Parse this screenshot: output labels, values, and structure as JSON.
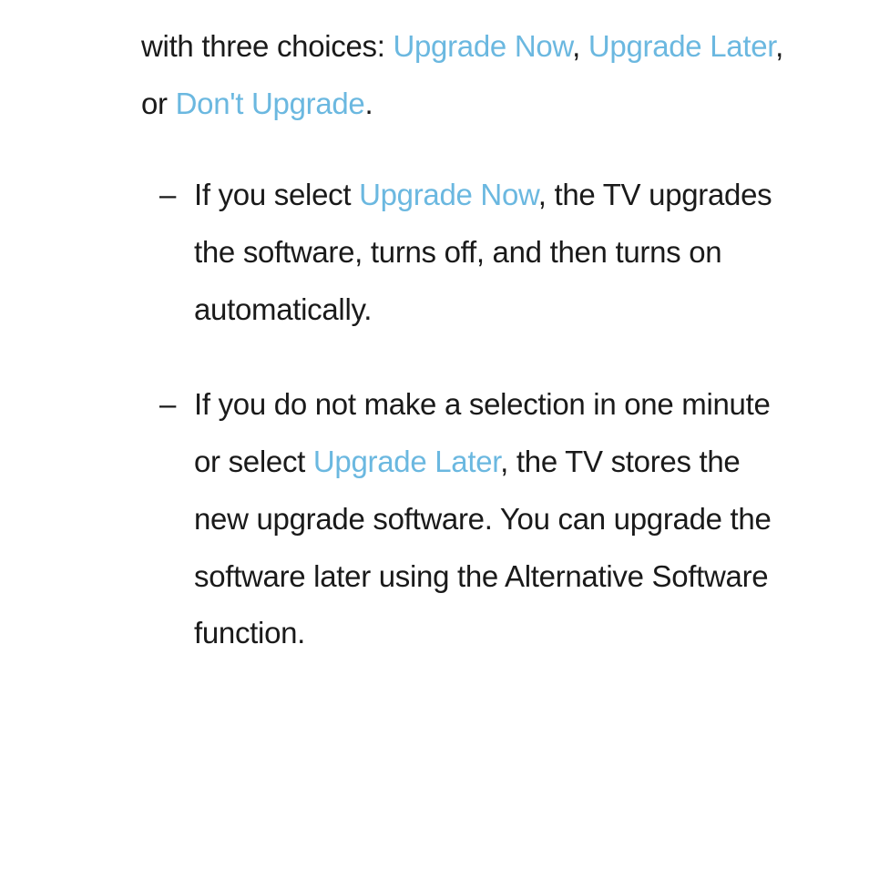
{
  "intro": {
    "pre": "with three choices: ",
    "link1": "Upgrade Now",
    "sep1": ", ",
    "link2": "Upgrade Later",
    "sep2": ", or ",
    "link3": "Don't Upgrade",
    "post": "."
  },
  "bullets": [
    {
      "dash": "–",
      "pre": "If you select ",
      "link1": "Upgrade Now",
      "post": ", the TV upgrades the software, turns off, and then turns on automatically."
    },
    {
      "dash": "–",
      "pre": "If you do not make a selection in one minute or select ",
      "link1": "Upgrade Later",
      "post": ", the TV stores the new upgrade software. You can upgrade the software later using the Alternative Software function."
    }
  ]
}
